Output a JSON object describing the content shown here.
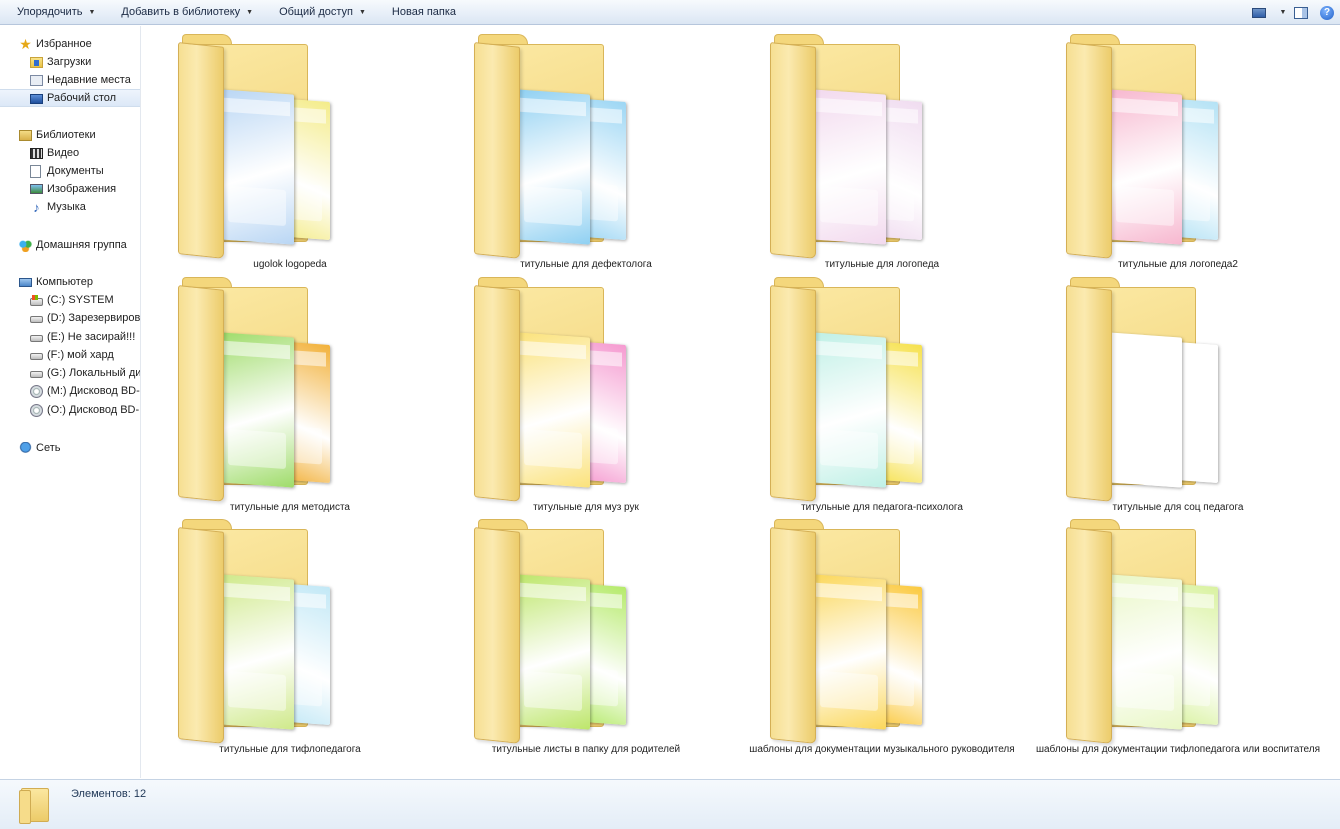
{
  "toolbar": {
    "organize": "Упорядочить",
    "add_to_library": "Добавить в библиотеку",
    "share": "Общий доступ",
    "new_folder": "Новая папка"
  },
  "nav": {
    "favorites": {
      "title": "Избранное",
      "items": [
        "Загрузки",
        "Недавние места",
        "Рабочий стол"
      ],
      "selected": "Рабочий стол"
    },
    "libraries": {
      "title": "Библиотеки",
      "items": [
        "Видео",
        "Документы",
        "Изображения",
        "Музыка"
      ]
    },
    "homegroup": {
      "title": "Домашняя группа"
    },
    "computer": {
      "title": "Компьютер",
      "items": [
        "(C:) SYSTEM",
        "(D:) Зарезервирова",
        "(E:) Не засирай!!!",
        "(F:) мой хард",
        "(G:) Локальный дис",
        "(M:) Дисковод BD-R",
        "(O:) Дисковод BD-R"
      ]
    },
    "network": {
      "title": "Сеть"
    }
  },
  "folders": [
    {
      "name": "ugolok logopeda",
      "doc_colors": [
        "#b9d6f4",
        "#f4ec8a"
      ]
    },
    {
      "name": "титульные для дефектолога",
      "doc_colors": [
        "#8fd0f2",
        "#9cd6f4"
      ]
    },
    {
      "name": "титульные для логопеда",
      "doc_colors": [
        "#f2d9ee",
        "#f0dcf0"
      ]
    },
    {
      "name": "титульные для логопеда2",
      "doc_colors": [
        "#f7b7cf",
        "#b4e2f5"
      ]
    },
    {
      "name": "титульные для методиста",
      "doc_colors": [
        "#9fdc6a",
        "#f2b13a"
      ]
    },
    {
      "name": "титульные для муз рук",
      "doc_colors": [
        "#fbe27a",
        "#f59ad0"
      ]
    },
    {
      "name": "титульные для педагога-психолога",
      "doc_colors": [
        "#bff0e6",
        "#f6e14d"
      ]
    },
    {
      "name": "титульные для соц педагога",
      "doc_colors": [
        "#ffffff",
        "#ffffff"
      ]
    },
    {
      "name": "титульные для тифлопедагога",
      "doc_colors": [
        "#cfe98a",
        "#c2e8f6"
      ]
    },
    {
      "name": "титульные листы в папку для родителей",
      "doc_colors": [
        "#bde66a",
        "#b5ea6a"
      ]
    },
    {
      "name": "шаблоны для документации музыкального руководителя",
      "doc_colors": [
        "#fbd75a",
        "#fbc93e"
      ]
    },
    {
      "name": "шаблоны для документации тифлопедагога или воспитателя",
      "doc_colors": [
        "#e9f7c6",
        "#d9f2a0"
      ]
    }
  ],
  "status": {
    "items_count": "Элементов: 12"
  },
  "colors": {
    "folder_yellow": "#f4d77c",
    "toolbar_bg": "#e6eef8",
    "selection": "#dce8f7"
  }
}
